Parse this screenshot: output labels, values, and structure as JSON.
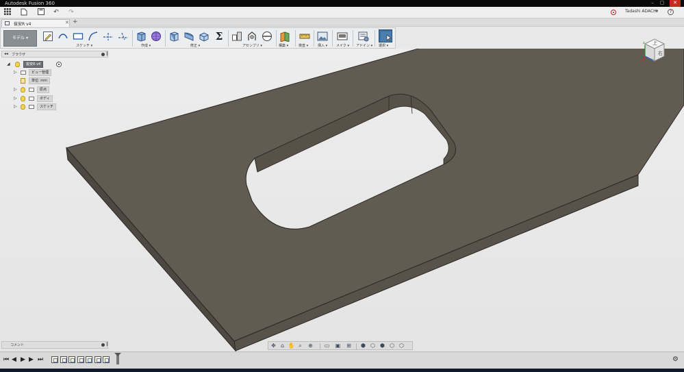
{
  "window": {
    "title": "Autodesk Fusion 360",
    "min_glyph": "–",
    "max_glyph": "▢",
    "close_glyph": "✕"
  },
  "quick_access": {
    "user_name": "Tadashi ADACHI",
    "user_chevron": "▾",
    "help_glyph": "?"
  },
  "document_tab": {
    "label": "抜安R v4",
    "close_glyph": "✕",
    "add_glyph": "+"
  },
  "ribbon": {
    "workspace_label": "モデル ▾",
    "groups": {
      "sketch": "スケッチ ▾",
      "create": "作成 ▾",
      "modify": "修正 ▾",
      "assemble": "アセンブリ ▾",
      "construct": "構築 ▾",
      "inspect": "検査 ▾",
      "insert": "挿入 ▾",
      "make": "メイク ▾",
      "addins": "アドイン ▾",
      "select": "選択 ▾"
    },
    "sigma_glyph": "Σ"
  },
  "browser": {
    "title": "ブラウザ",
    "collapse_glyph": "◂◂",
    "pin_glyph": "‖",
    "root": {
      "label": "抜安R v4"
    },
    "items": [
      {
        "label": "ビュー管理"
      },
      {
        "label": "単位: mm"
      },
      {
        "label": "原点"
      },
      {
        "label": "ボディ"
      },
      {
        "label": "スケッチ"
      }
    ]
  },
  "viewcube": {
    "top_label": "上",
    "front_label": "右",
    "axis_x": "x",
    "axis_y": "y",
    "axis_z": "z"
  },
  "comments": {
    "title": "コメント",
    "pin_glyph": "‖"
  },
  "timeline": {
    "first_glyph": "⏮",
    "prev_glyph": "◀",
    "play_glyph": "▶",
    "next_glyph": "▶",
    "last_glyph": "⏭",
    "settings_glyph": "⚙"
  },
  "colors": {
    "model_top": "#615b52",
    "model_side": "#4d4841",
    "model_front": "#57524a",
    "ribbon_bg": "#eceef0",
    "title_bg": "#0a0a0a"
  }
}
